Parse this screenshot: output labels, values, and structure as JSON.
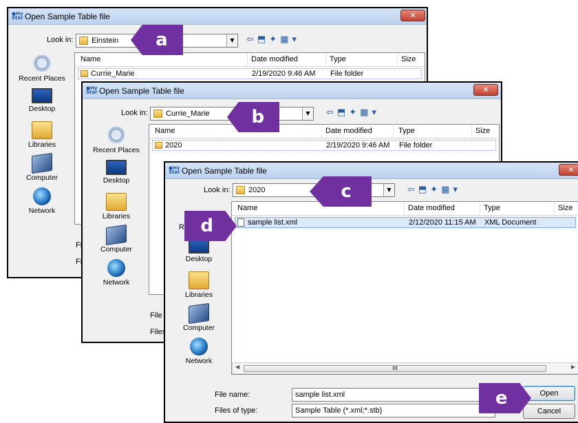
{
  "dialog1": {
    "title": "Open Sample Table file",
    "look_in_label": "Look in:",
    "look_in_value": "Einstein",
    "columns": [
      "Name",
      "Date modified",
      "Type",
      "Size"
    ],
    "rows": [
      {
        "name": "Currie_Marie",
        "date": "2/19/2020 9:46 AM",
        "type": "File folder"
      }
    ],
    "places": [
      "Recent Places",
      "Desktop",
      "Libraries",
      "Computer",
      "Network"
    ],
    "file_name_label_partial": "File",
    "files_type_label_partial": "File"
  },
  "dialog2": {
    "title": "Open Sample Table file",
    "look_in_label": "Look in:",
    "look_in_value": "Currie_Marie",
    "columns": [
      "Name",
      "Date modified",
      "Type",
      "Size"
    ],
    "rows": [
      {
        "name": "2020",
        "date": "2/19/2020 9:46 AM",
        "type": "File folder"
      }
    ],
    "places": [
      "Recent Places",
      "Desktop",
      "Libraries",
      "Computer",
      "Network"
    ],
    "file_name_label_partial": "File n",
    "files_type_label_partial": "Files o"
  },
  "dialog3": {
    "title": "Open Sample Table file",
    "look_in_label": "Look in:",
    "look_in_value": "2020",
    "columns": [
      "Name",
      "Date modified",
      "Type",
      "Size"
    ],
    "rows": [
      {
        "name": "sample list.xml",
        "date": "2/12/2020 11:15 AM",
        "type": "XML Document"
      }
    ],
    "places": [
      "Desktop",
      "Libraries",
      "Computer",
      "Network"
    ],
    "places_partial_label": "Re",
    "file_name_label": "File name:",
    "file_name_value": "sample list.xml",
    "files_type_label": "Files of type:",
    "files_type_value": "Sample Table (*.xml;*.stb)",
    "open_button": "Open",
    "cancel_button": "Cancel",
    "scroll_grip": "III"
  },
  "callouts": [
    "a",
    "b",
    "c",
    "d",
    "e"
  ],
  "colors": {
    "callout": "#7030a0",
    "close_button": "#c4402f",
    "selection": "#dbe8f9"
  }
}
